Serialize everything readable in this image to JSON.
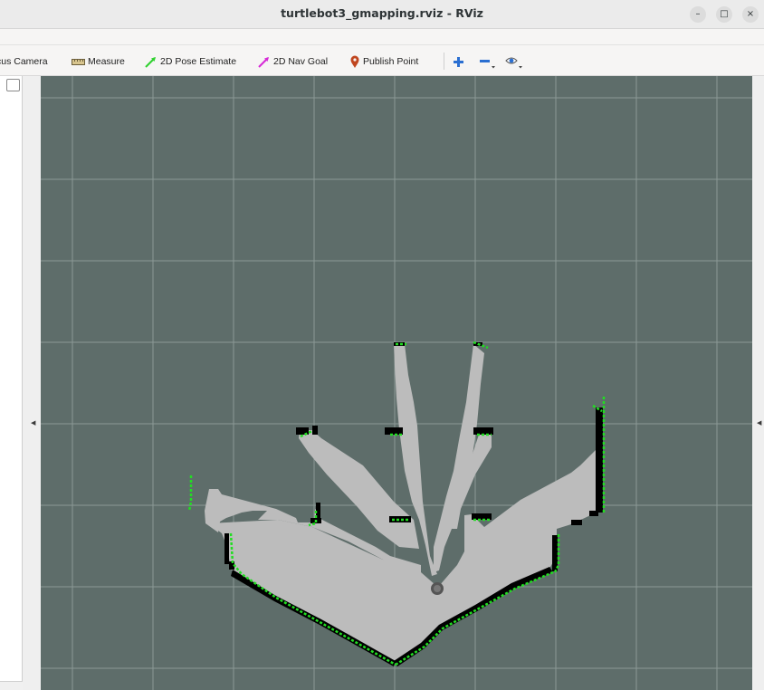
{
  "window": {
    "title": "turtlebot3_gmapping.rviz - RViz",
    "minimize_glyph": "–",
    "maximize_glyph": "□",
    "close_glyph": "×"
  },
  "toolbar": {
    "focus_camera": {
      "label": "cus Camera",
      "icon": "camera-icon"
    },
    "measure": {
      "label": "Measure",
      "icon": "ruler-icon"
    },
    "pose_estimate": {
      "label": "2D Pose Estimate",
      "icon": "green-arrow-icon"
    },
    "nav_goal": {
      "label": "2D Nav Goal",
      "icon": "magenta-arrow-icon"
    },
    "publish_point": {
      "label": "Publish Point",
      "icon": "map-pin-icon"
    },
    "zoom_in": {
      "icon": "plus-icon"
    },
    "zoom_out": {
      "icon": "minus-icon"
    },
    "view": {
      "icon": "eye-icon"
    }
  },
  "splitters": {
    "left_arrow": "◀",
    "right_arrow": "◀"
  },
  "colors": {
    "viewport_bg": "#5e6d6a",
    "grid_lines": "#8c9996",
    "free_space": "#bcbcbc",
    "obstacle": "#000000",
    "laser_scan": "#22dd22",
    "robot": "#555555",
    "pose_estimate_arrow": "#2fd12f",
    "nav_goal_arrow": "#d62ad6",
    "publish_point_pin": "#c0461f",
    "zoom_icons": "#2b6fd1"
  }
}
